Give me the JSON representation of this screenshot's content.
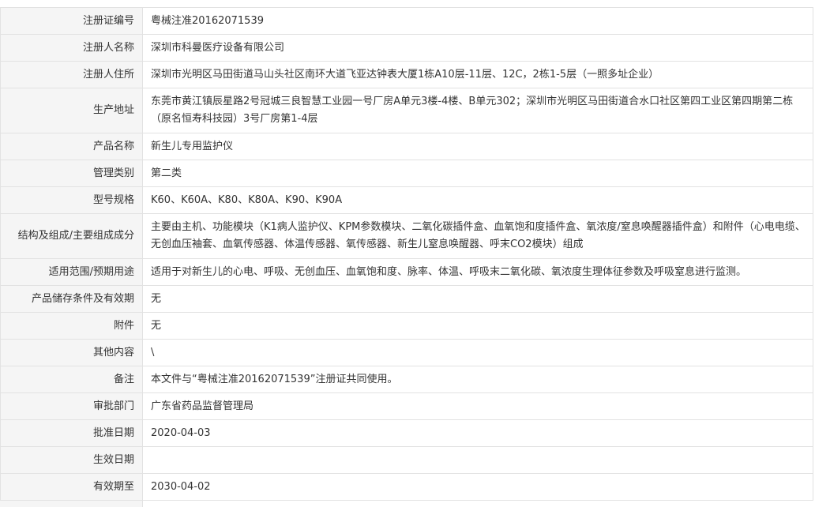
{
  "rows": [
    {
      "label": "注册证编号",
      "value": "粤械注准20162071539"
    },
    {
      "label": "注册人名称",
      "value": "深圳市科曼医疗设备有限公司"
    },
    {
      "label": "注册人住所",
      "value": "深圳市光明区马田街道马山头社区南环大道飞亚达钟表大厦1栋A10层-11层、12C，2栋1-5层（一照多址企业）"
    },
    {
      "label": "生产地址",
      "value": "东莞市黄江镇辰星路2号冠城三良智慧工业园一号厂房A单元3楼-4楼、B单元302；深圳市光明区马田街道合水口社区第四工业区第四期第二栋（原名恒寿科技园）3号厂房第1-4层"
    },
    {
      "label": "产品名称",
      "value": "新生儿专用监护仪"
    },
    {
      "label": "管理类别",
      "value": "第二类"
    },
    {
      "label": "型号规格",
      "value": "K60、K60A、K80、K80A、K90、K90A"
    },
    {
      "label": "结构及组成/主要组成成分",
      "value": "主要由主机、功能模块（K1病人监护仪、KPM参数模块、二氧化碳插件盒、血氧饱和度插件盒、氧浓度/窒息唤醒器插件盒）和附件（心电电缆、无创血压袖套、血氧传感器、体温传感器、氧传感器、新生儿窒息唤醒器、呼末CO2模块）组成"
    },
    {
      "label": "适用范围/预期用途",
      "value": "适用于对新生儿的心电、呼吸、无创血压、血氧饱和度、脉率、体温、呼吸末二氧化碳、氧浓度生理体征参数及呼吸窒息进行监测。"
    },
    {
      "label": "产品储存条件及有效期",
      "value": "无"
    },
    {
      "label": "附件",
      "value": "无"
    },
    {
      "label": "其他内容",
      "value": "\\"
    },
    {
      "label": "备注",
      "value": "本文件与“粤械注准20162071539”注册证共同使用。"
    },
    {
      "label": "审批部门",
      "value": "广东省药品监督管理局"
    },
    {
      "label": "批准日期",
      "value": "2020-04-03"
    },
    {
      "label": "生效日期",
      "value": ""
    },
    {
      "label": "有效期至",
      "value": "2030-04-02"
    }
  ]
}
